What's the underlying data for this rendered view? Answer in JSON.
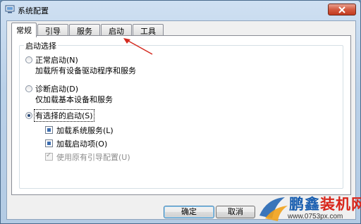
{
  "window": {
    "title": "系统配置",
    "close_icon": "close-x-icon"
  },
  "tabs": [
    {
      "label": "常规",
      "active": true
    },
    {
      "label": "引导",
      "active": false
    },
    {
      "label": "服务",
      "active": false
    },
    {
      "label": "启动",
      "active": false
    },
    {
      "label": "工具",
      "active": false
    }
  ],
  "startup": {
    "group_title": "启动选择",
    "normal": {
      "label": "正常启动(N)",
      "desc": "加载所有设备驱动程序和服务",
      "checked": false
    },
    "diagnostic": {
      "label": "诊断启动(D)",
      "desc": "仅加载基本设备和服务",
      "checked": false
    },
    "selective": {
      "label": "有选择的启动(S)",
      "checked": true
    },
    "options": [
      {
        "label": "加载系统服务(L)",
        "checked": true,
        "enabled": true
      },
      {
        "label": "加载启动项(O)",
        "checked": true,
        "enabled": true
      },
      {
        "label": "使用原有引导配置(U)",
        "checked": true,
        "enabled": false
      }
    ]
  },
  "buttons": {
    "ok": "确定",
    "cancel": "取消"
  },
  "watermark": {
    "name_part1": "鹏鑫",
    "name_part2": "装机网",
    "url": "www.0753px.com"
  },
  "colors": {
    "annotation_arrow": "#d42a1f",
    "watermark_blue": "#1a5fb0",
    "watermark_red": "#d8261b"
  }
}
